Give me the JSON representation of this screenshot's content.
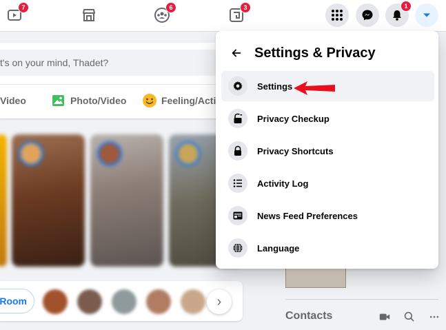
{
  "topnav": {
    "watch_badge": "7",
    "groups_badge": "6",
    "gaming_badge": "3",
    "notifications_badge": "1"
  },
  "composer": {
    "placeholder": "t's on your mind, Thadet?",
    "actions": [
      {
        "label": "Video",
        "icon": "live-video-icon"
      },
      {
        "label": "Photo/Video",
        "icon": "photo-icon"
      },
      {
        "label": "Feeling/Activ",
        "icon": "feeling-icon"
      }
    ]
  },
  "rooms": {
    "button_label": "Room"
  },
  "contacts": {
    "title": "Contacts"
  },
  "settings_menu": {
    "title": "Settings & Privacy",
    "items": [
      {
        "label": "Settings",
        "icon": "gear-icon",
        "selected": true
      },
      {
        "label": "Privacy Checkup",
        "icon": "lock-arrow-icon"
      },
      {
        "label": "Privacy Shortcuts",
        "icon": "lock-icon"
      },
      {
        "label": "Activity Log",
        "icon": "list-icon"
      },
      {
        "label": "News Feed Preferences",
        "icon": "feed-icon"
      },
      {
        "label": "Language",
        "icon": "globe-icon"
      }
    ]
  },
  "colors": {
    "accent": "#1877f2",
    "badge": "#e41e3f",
    "annotation_arrow": "#e8101e"
  }
}
